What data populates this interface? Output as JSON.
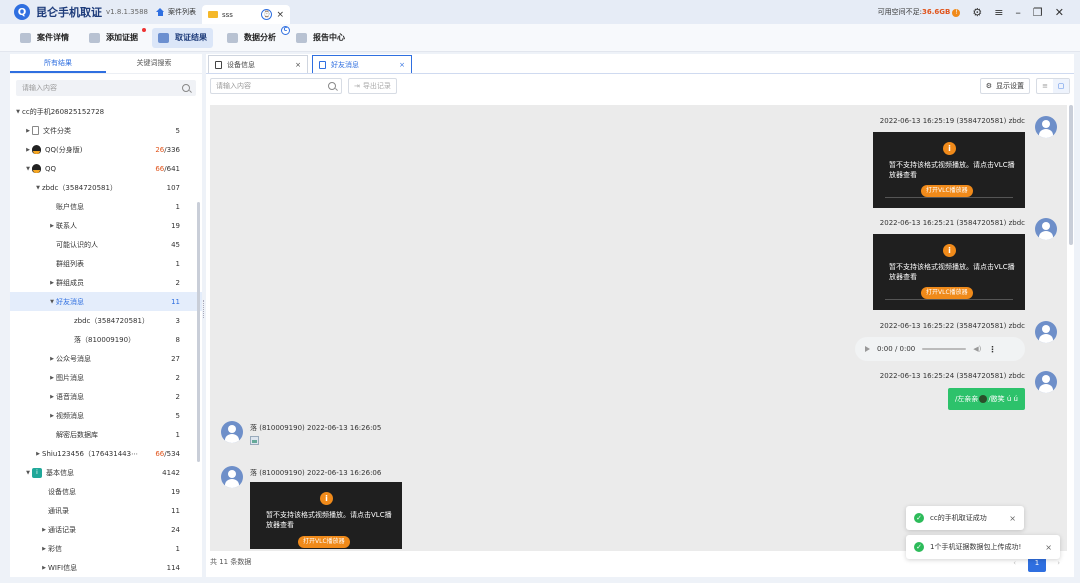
{
  "app": {
    "name": "昆仑手机取证",
    "version": "v1.8.1.3588",
    "home_tab": "案件列表",
    "case_tab": "sss",
    "space_label": "可用空间不足:",
    "space_value": "36.6GB"
  },
  "toolbar": {
    "items": [
      "案件详情",
      "添加证据",
      "取证结果",
      "数据分析",
      "报告中心"
    ]
  },
  "left": {
    "tabs": [
      "所有结果",
      "关键词搜索"
    ],
    "search_placeholder": "请输入内容",
    "tree": [
      {
        "label": "cc的手机260825152728",
        "count": ""
      },
      {
        "label": "文件分类",
        "count": "5"
      },
      {
        "label": "QQ(分身版)",
        "count_red": "26",
        "count_total": "/336"
      },
      {
        "label": "QQ",
        "count_red": "66",
        "count_total": "/641"
      },
      {
        "label": "zbdc（3584720581）",
        "count": "107"
      },
      {
        "label": "账户信息",
        "count": "1"
      },
      {
        "label": "联系人",
        "count": "19"
      },
      {
        "label": "可能认识的人",
        "count": "45"
      },
      {
        "label": "群组列表",
        "count": "1"
      },
      {
        "label": "群组成员",
        "count": "2"
      },
      {
        "label": "好友消息",
        "count": "11"
      },
      {
        "label": "zbdc（3584720581）",
        "count": "3"
      },
      {
        "label": "落（810009190）",
        "count": "8"
      },
      {
        "label": "公众号消息",
        "count": "27"
      },
      {
        "label": "图片消息",
        "count": "2"
      },
      {
        "label": "语音消息",
        "count": "2"
      },
      {
        "label": "视频消息",
        "count": "5"
      },
      {
        "label": "解密后数据库",
        "count": "1"
      },
      {
        "label": "Shiu123456（176431443⋯",
        "count_red": "66",
        "count_total": "/534"
      },
      {
        "label": "基本信息",
        "count": "4142"
      },
      {
        "label": "设备信息",
        "count": "19"
      },
      {
        "label": "通讯录",
        "count": "11"
      },
      {
        "label": "通话记录",
        "count": "24"
      },
      {
        "label": "彩信",
        "count": "1"
      },
      {
        "label": "WIFI信息",
        "count": "114"
      }
    ]
  },
  "right": {
    "tabs": [
      "设备信息",
      "好友消息"
    ],
    "search_placeholder": "请输入内容",
    "export_label": "导出记录",
    "display_settings": "显示设置",
    "footer": "共 11 条数据",
    "page": "1"
  },
  "messages": {
    "m1_head": "2022-06-13 16:25:19 (3584720581) zbdc",
    "m2_head": "2022-06-13 16:25:21 (3584720581) zbdc",
    "m3_head": "2022-06-13 16:25:22 (3584720581) zbdc",
    "m4_head": "2022-06-13 16:25:24 (3584720581) zbdc",
    "m5_head": "落 (810009190) 2022-06-13 16:26:05",
    "m6_head": "落 (810009190) 2022-06-13 16:26:06",
    "video_notice": "暂不支持该格式视频播放。请点击VLC播放器查看",
    "video_button": "打开VLC播放器",
    "audio_time": "0:00 / 0:00",
    "text_part1": "/左亲亲",
    "text_part2": "/憨笑 ú ú"
  },
  "toasts": {
    "t1": "cc的手机取证成功",
    "t2": "1个手机证据数据包上传成功!"
  },
  "colors": {
    "accent": "#2f6fe0",
    "warning": "#e0531a",
    "bubble_green": "#2dc26b",
    "success": "#2dbb5a"
  },
  "icons": [
    "app-logo-icon",
    "home-icon",
    "folder-icon",
    "settings-icon",
    "menu-icon",
    "minimize-icon",
    "maximize-icon",
    "close-icon",
    "search-icon",
    "avatar-icon",
    "info-icon",
    "check-icon"
  ]
}
